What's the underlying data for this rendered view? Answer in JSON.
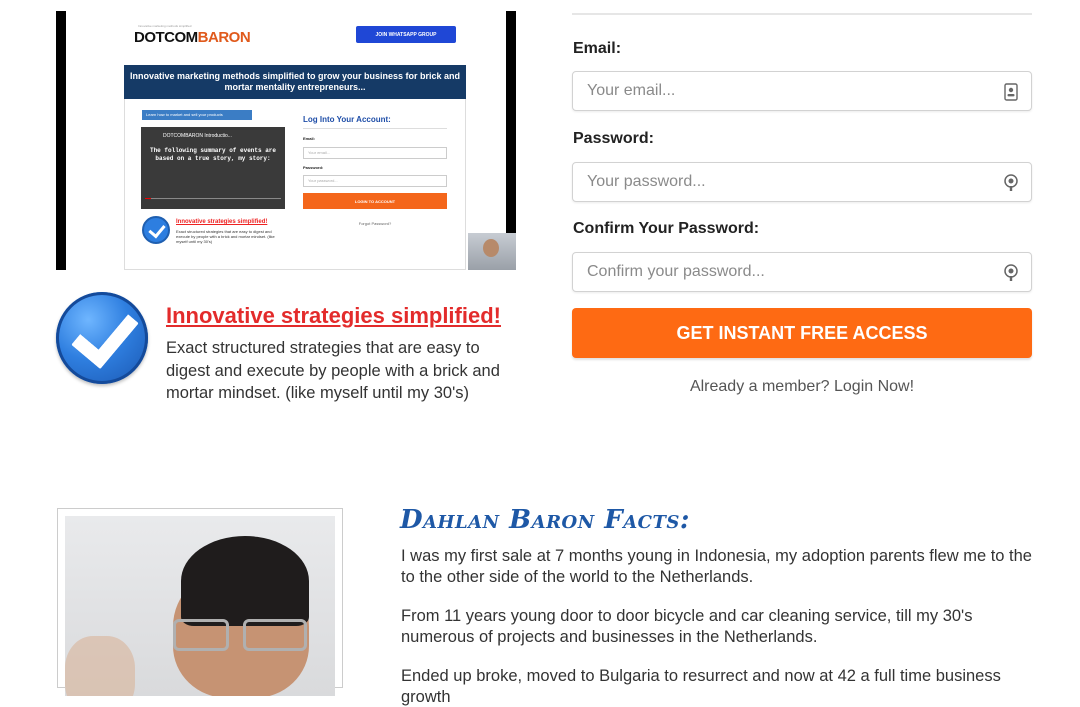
{
  "preview": {
    "brand_left": "DOTCOM",
    "brand_right": "BARON",
    "brand_tag": "Innovative marketing methods simplified",
    "whatsapp_btn": "JOIN WHATSAPP GROUP",
    "banner": "Innovative marketing methods simplified to grow your business for brick and mortar mentality entrepreneurs...",
    "learn_link": "Learn how to market and sell your products",
    "video_title": "DOTCOMBARON Introductio...",
    "video_text": "The following summary of events are based on a true story, my story:",
    "feature_title": "Innovative strategies simplified!",
    "feature_desc": "Exact structured strategies that are easy to digest and execute by people with a brick and mortar mindset. (like myself until my 30's)",
    "login_title": "Log Into Your Account:",
    "email_label": "Email:",
    "email_placeholder": "Your email...",
    "password_label": "Password:",
    "password_placeholder": "Your password...",
    "login_button": "LOGIN TO ACCOUNT",
    "forgot": "Forgot Password?"
  },
  "feature": {
    "title": "Innovative strategies simplified!",
    "description": "Exact structured strategies that are easy to digest and execute by people with a brick and mortar mindset. (like myself until my 30's)"
  },
  "form": {
    "email_label": "Email:",
    "email_placeholder": "Your email...",
    "password_label": "Password:",
    "password_placeholder": "Your password...",
    "confirm_label": "Confirm Your Password:",
    "confirm_placeholder": "Confirm your password...",
    "submit_label": "GET INSTANT FREE ACCESS",
    "login_link": "Already a member? Login Now!",
    "accent_color": "#fe6a13"
  },
  "facts": {
    "title": "Dahlan Baron Facts:",
    "paragraphs": [
      "I was my first sale at 7 months young in Indonesia, my adoption parents flew me to the to the other side of the world to the Netherlands.",
      "From 11 years young door to door bicycle and car cleaning service, till my 30's numerous of projects and businesses in the Netherlands.",
      "Ended up broke, moved to Bulgaria to resurrect and now at 42 a full time business growth"
    ]
  }
}
